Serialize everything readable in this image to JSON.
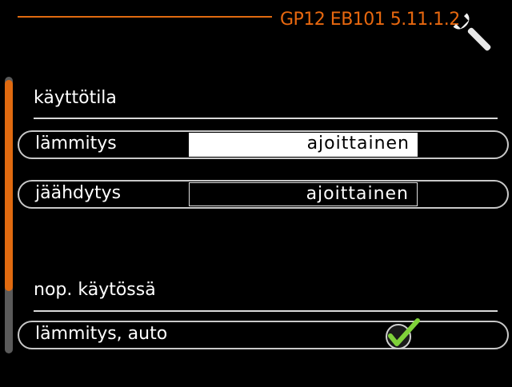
{
  "header": {
    "title": "GP12  EB101 5.11.1.2",
    "icon": "wrench-icon",
    "accent_color": "#e06a10"
  },
  "sections": {
    "mode": {
      "heading": "käyttötila",
      "rows": [
        {
          "label": "lämmitys",
          "value": "ajoittainen",
          "selected": true
        },
        {
          "label": "jäähdytys",
          "value": "ajoittainen",
          "selected": false
        }
      ]
    },
    "quick": {
      "heading": "nop. käytössä",
      "rows": [
        {
          "label": "lämmitys, auto",
          "checked": true
        }
      ]
    }
  }
}
